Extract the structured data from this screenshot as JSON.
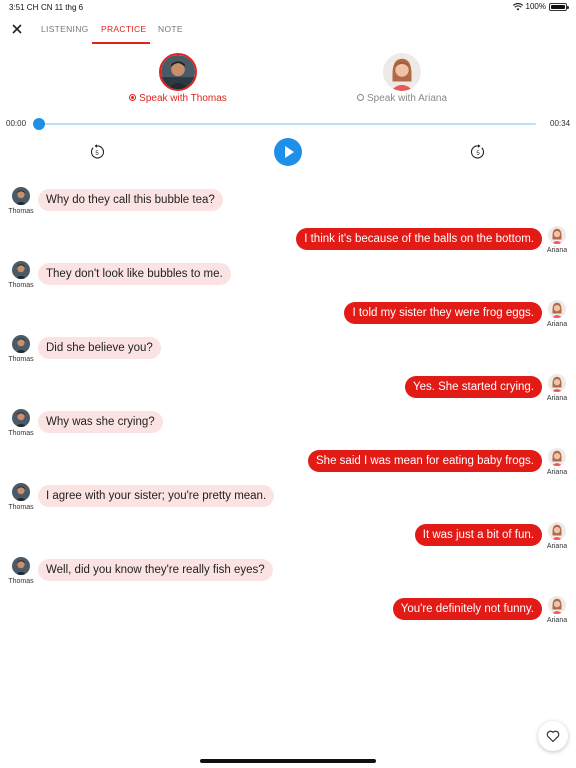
{
  "status_bar": {
    "time": "3:51 CH",
    "date": "CN 11 thg 6",
    "battery": "100%"
  },
  "tabs": [
    {
      "label": "LISTENING",
      "active": false
    },
    {
      "label": "PRACTICE",
      "active": true
    },
    {
      "label": "NOTE",
      "active": false
    }
  ],
  "speakers": [
    {
      "label": "Speak with Thomas",
      "selected": true
    },
    {
      "label": "Speak with Ariana",
      "selected": false
    }
  ],
  "player": {
    "current_time": "00:00",
    "total_time": "00:34",
    "progress": 0,
    "rewind_seconds": "5",
    "forward_seconds": "5"
  },
  "colors": {
    "accent_red": "#e31b16",
    "player_blue": "#1e90e8",
    "left_bubble": "#fbe3e3"
  },
  "messages": [
    {
      "speaker": "Thomas",
      "side": "left",
      "text": "Why do they call this bubble tea?"
    },
    {
      "speaker": "Ariana",
      "side": "right",
      "text": "I think it's because of the balls on the bottom."
    },
    {
      "speaker": "Thomas",
      "side": "left",
      "text": "They don't look like bubbles to me."
    },
    {
      "speaker": "Ariana",
      "side": "right",
      "text": "I told my sister they were frog eggs."
    },
    {
      "speaker": "Thomas",
      "side": "left",
      "text": "Did she believe you?"
    },
    {
      "speaker": "Ariana",
      "side": "right",
      "text": "Yes. She started crying."
    },
    {
      "speaker": "Thomas",
      "side": "left",
      "text": "Why was she crying?"
    },
    {
      "speaker": "Ariana",
      "side": "right",
      "text": "She said I was mean for eating baby frogs."
    },
    {
      "speaker": "Thomas",
      "side": "left",
      "text": "I agree with your sister; you're pretty mean."
    },
    {
      "speaker": "Ariana",
      "side": "right",
      "text": "It was just a bit of fun."
    },
    {
      "speaker": "Thomas",
      "side": "left",
      "text": "Well, did you know they're really fish eyes?"
    },
    {
      "speaker": "Ariana",
      "side": "right",
      "text": "You're definitely not funny."
    }
  ]
}
